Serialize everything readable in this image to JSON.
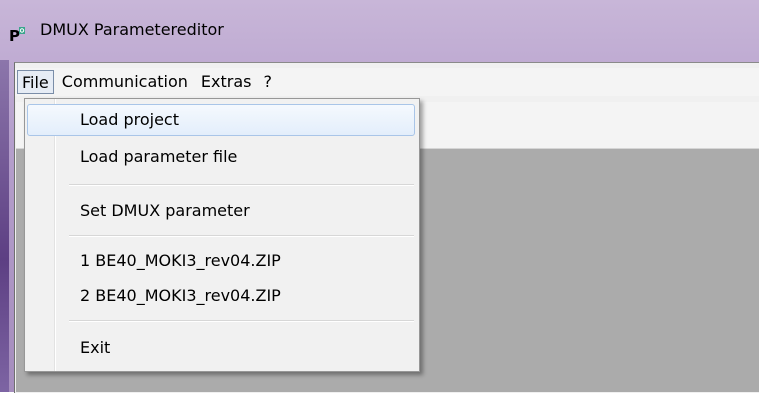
{
  "window": {
    "title": "DMUX Parametereditor",
    "icon": "pc-app-icon"
  },
  "menubar": {
    "items": [
      "File",
      "Communication",
      "Extras",
      "?"
    ]
  },
  "file_menu": {
    "load_project": "Load project",
    "load_parameter_file": "Load parameter file",
    "set_dmux_parameter": "Set DMUX parameter",
    "recent_1": "1 BE40_MOKI3_rev04.ZIP",
    "recent_2": "2 BE40_MOKI3_rev04.ZIP",
    "exit": "Exit"
  },
  "colors": {
    "frame": "#b59fcc",
    "workspace": "#ababab",
    "highlight_border": "#a9c5e8"
  }
}
